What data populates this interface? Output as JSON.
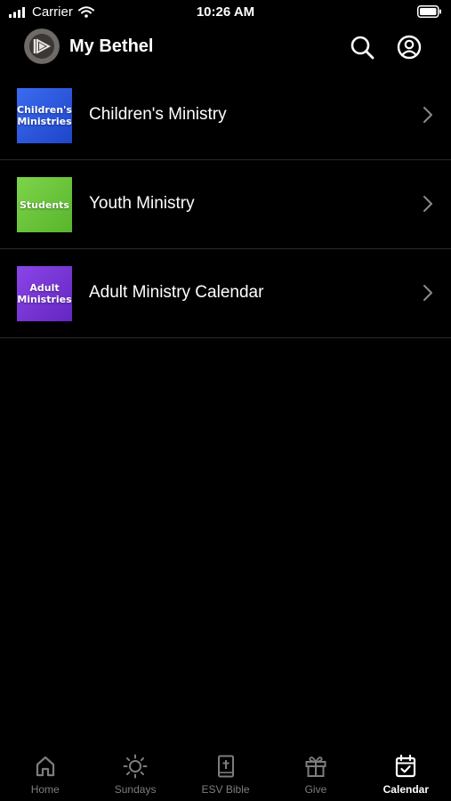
{
  "status_bar": {
    "carrier": "Carrier",
    "time": "10:26 AM"
  },
  "header": {
    "title": "My Bethel",
    "avatar_icon": "bethel-logo-icon",
    "search_icon": "search-icon",
    "profile_icon": "profile-circle-icon"
  },
  "list": {
    "items": [
      {
        "label": "Children's Ministry",
        "thumb_text": "Children's\nMinistries",
        "thumb_color": "#2f5fe0"
      },
      {
        "label": "Youth Ministry",
        "thumb_text": "Students",
        "thumb_color": "#6cc83a"
      },
      {
        "label": "Adult Ministry Calendar",
        "thumb_text": "Adult\nMinistries",
        "thumb_color": "#7b35d6"
      }
    ]
  },
  "tabs": [
    {
      "label": "Home",
      "icon": "home-icon",
      "active": false
    },
    {
      "label": "Sundays",
      "icon": "sun-icon",
      "active": false
    },
    {
      "label": "ESV Bible",
      "icon": "bible-icon",
      "active": false
    },
    {
      "label": "Give",
      "icon": "gift-icon",
      "active": false
    },
    {
      "label": "Calendar",
      "icon": "calendar-check-icon",
      "active": true
    }
  ],
  "colors": {
    "background": "#000000",
    "text": "#ffffff",
    "inactive_tab": "#7d7d7d",
    "divider": "#2a2a2a"
  }
}
